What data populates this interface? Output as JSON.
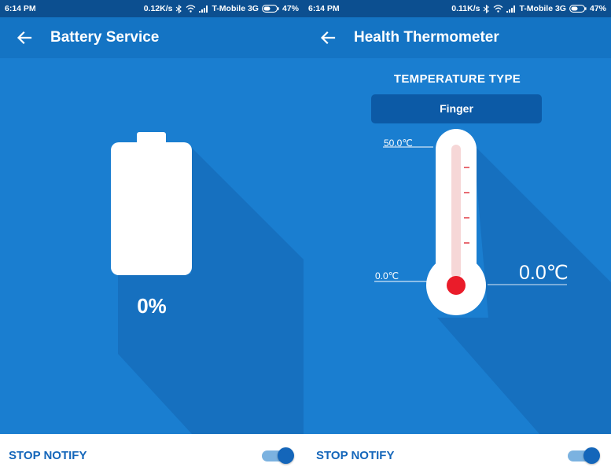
{
  "status_left": {
    "time": "6:14 PM",
    "speed": "0.12K/s",
    "carrier": "T-Mobile 3G",
    "battery": "47%"
  },
  "status_right": {
    "time": "6:14 PM",
    "speed": "0.11K/s",
    "carrier": "T-Mobile 3G",
    "battery": "47%"
  },
  "battery_screen": {
    "title": "Battery Service",
    "battery_level_text": "0%",
    "battery_level": 0,
    "stop_notify_label": "STOP NOTIFY",
    "notify_enabled": true
  },
  "thermometer_screen": {
    "title": "Health Thermometer",
    "temperature_type_heading": "TEMPERATURE TYPE",
    "temperature_type_value": "Finger",
    "scale_max": "50.0℃",
    "scale_min": "0.0℃",
    "reading": "0.0℃",
    "stop_notify_label": "STOP NOTIFY",
    "notify_enabled": true
  },
  "colors": {
    "status_bar": "#0c4f90",
    "app_bar": "#1474c4",
    "content_bg": "#1a7ed0",
    "accent": "#1466ba",
    "thermometer_bulb": "#ea1c2a",
    "thermometer_tube": "#f6d7d7"
  },
  "icons": [
    "back-arrow-icon",
    "bluetooth-icon",
    "wifi-icon",
    "signal-icon",
    "battery-status-icon"
  ]
}
